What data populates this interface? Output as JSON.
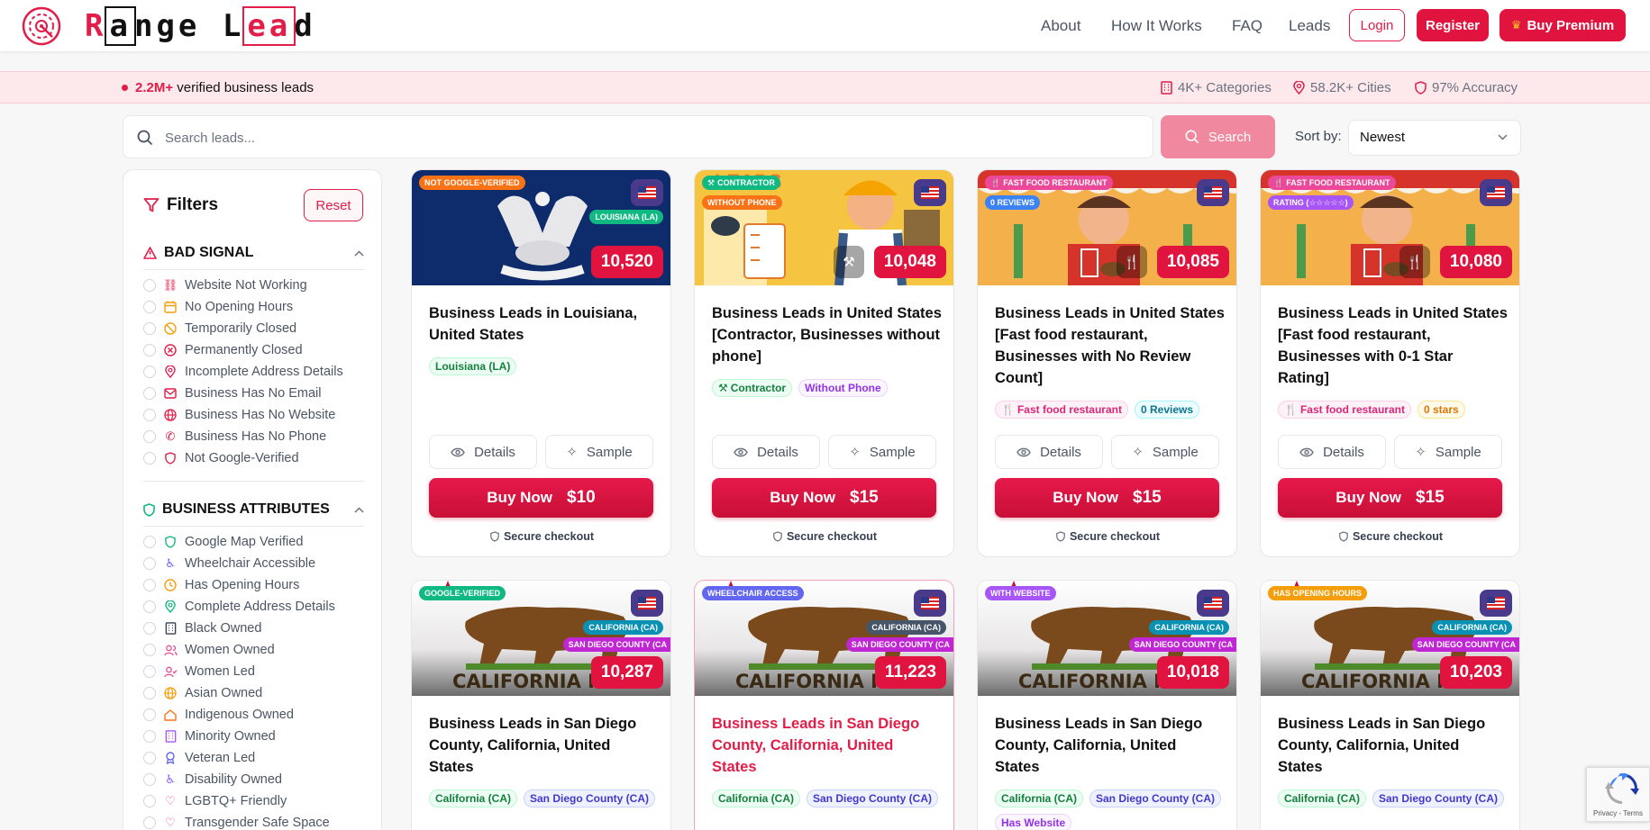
{
  "brand": {
    "name_parts": [
      "R",
      "a",
      "nge L",
      "ea",
      "d"
    ]
  },
  "nav": {
    "about": "About",
    "how": "How It Works",
    "faq": "FAQ",
    "leads": "Leads",
    "login": "Login",
    "register": "Register",
    "premium": "Buy Premium"
  },
  "info": {
    "count": "2.2M+",
    "text": "verified business leads",
    "categories": "4K+ Categories",
    "cities": "58.2K+ Cities",
    "accuracy": "97% Accuracy"
  },
  "search": {
    "placeholder": "Search leads...",
    "button": "Search",
    "sort_label": "Sort by:",
    "sort_value": "Newest"
  },
  "filters": {
    "title": "Filters",
    "reset": "Reset",
    "bad_title": "BAD SIGNAL",
    "bad": [
      "Website Not Working",
      "No Opening Hours",
      "Temporarily Closed",
      "Permanently Closed",
      "Incomplete Address Details",
      "Business Has No Email",
      "Business Has No Website",
      "Business Has No Phone",
      "Not Google-Verified"
    ],
    "attr_title": "BUSINESS ATTRIBUTES",
    "attr": [
      "Google Map Verified",
      "Wheelchair Accessible",
      "Has Opening Hours",
      "Complete Address Details",
      "Black Owned",
      "Women Owned",
      "Women Led",
      "Asian Owned",
      "Indigenous Owned",
      "Minority Owned",
      "Veteran Led",
      "Disability Owned",
      "LGBTQ+ Friendly",
      "Transgender Safe Space"
    ]
  },
  "cards": [
    {
      "badge": "NOT GOOGLE-VERIFIED",
      "badge2": "",
      "loc1": "LOUISIANA (LA)",
      "loc2": "",
      "count": "10,520",
      "title": "Business Leads in Louisiana, United States",
      "tags": [
        "Louisiana (LA)"
      ],
      "price": "$10"
    },
    {
      "badge": "CONTRACTOR",
      "badge2": "WITHOUT PHONE",
      "loc1": "",
      "loc2": "",
      "count": "10,048",
      "title": "Business Leads in United States [Contractor, Businesses without phone]",
      "tags": [
        "Contractor",
        "Without Phone"
      ],
      "price": "$15"
    },
    {
      "badge": "FAST FOOD RESTAURANT",
      "badge2": "0 REVIEWS",
      "loc1": "",
      "loc2": "",
      "count": "10,085",
      "title": "Business Leads in United States [Fast food restaurant, Businesses with No Review Count]",
      "tags": [
        "Fast food restaurant",
        "0 Reviews"
      ],
      "price": "$15"
    },
    {
      "badge": "FAST FOOD RESTAURANT",
      "badge2": "RATING (☆☆☆☆☆)",
      "loc1": "",
      "loc2": "",
      "count": "10,080",
      "title": "Business Leads in United States [Fast food restaurant, Businesses with 0-1 Star Rating]",
      "tags": [
        "Fast food restaurant",
        "0 stars"
      ],
      "price": "$15"
    },
    {
      "badge": "GOOGLE-VERIFIED",
      "badge2": "",
      "loc1": "CALIFORNIA (CA)",
      "loc2": "SAN DIEGO COUNTY (CA",
      "count": "10,287",
      "title": "Business Leads in San Diego County, California, United States",
      "tags": [
        "California (CA)",
        "San Diego County (CA)"
      ],
      "price": ""
    },
    {
      "badge": "WHEELCHAIR ACCESS",
      "badge2": "",
      "loc1": "CALIFORNIA (CA)",
      "loc2": "SAN DIEGO COUNTY (CA",
      "count": "11,223",
      "title": "Business Leads in San Diego County, California, United States",
      "tags": [
        "California (CA)",
        "San Diego County (CA)"
      ],
      "price": ""
    },
    {
      "badge": "WITH WEBSITE",
      "badge2": "",
      "loc1": "CALIFORNIA (CA)",
      "loc2": "SAN DIEGO COUNTY (CA",
      "count": "10,018",
      "title": "Business Leads in San Diego County, California, United States",
      "tags": [
        "California (CA)",
        "San Diego County (CA)",
        "Has Website"
      ],
      "price": ""
    },
    {
      "badge": "HAS OPENING HOURS",
      "badge2": "",
      "loc1": "CALIFORNIA (CA)",
      "loc2": "SAN DIEGO COUNTY (CA",
      "count": "10,203",
      "title": "Business Leads in San Diego County, California, United States",
      "tags": [
        "California (CA)",
        "San Diego County (CA)"
      ],
      "price": ""
    }
  ],
  "card_labels": {
    "details": "Details",
    "sample": "Sample",
    "buy": "Buy Now",
    "secure": "Secure checkout"
  },
  "flag_image": "california-bear-republic",
  "recaptcha": {
    "text": "Privacy - Terms"
  }
}
